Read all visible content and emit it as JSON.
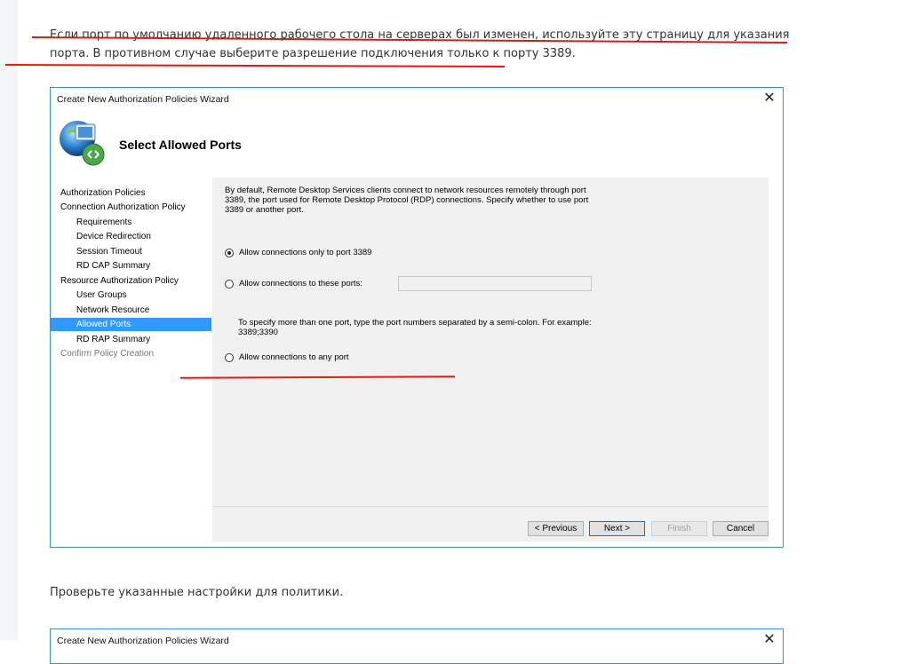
{
  "article": {
    "paragraph1": "Если порт по умолчанию удаленного рабочего стола на серверах был изменен, используйте эту страницу для указания порта. В противном случае выберите разрешение подключения только к порту 3389.",
    "paragraph2": "Проверьте указанные настройки для политики."
  },
  "dialog": {
    "window_title": "Create New Authorization Policies Wizard",
    "close_glyph": "✕",
    "page_title": "Select Allowed Ports",
    "nav": [
      {
        "label": "Authorization Policies"
      },
      {
        "label": "Connection Authorization Policy"
      },
      {
        "label": "Requirements"
      },
      {
        "label": "Device Redirection"
      },
      {
        "label": "Session Timeout"
      },
      {
        "label": "RD CAP Summary"
      },
      {
        "label": "Resource Authorization Policy"
      },
      {
        "label": "User Groups"
      },
      {
        "label": "Network Resource"
      },
      {
        "label": "Allowed Ports"
      },
      {
        "label": "RD RAP Summary"
      },
      {
        "label": "Confirm Policy Creation"
      }
    ],
    "description": "By default, Remote Desktop Services clients connect to network resources remotely through port 3389, the port used for Remote Desktop Protocol (RDP) connections. Specify whether to use port 3389 or another port.",
    "option_only_3389": "Allow connections only to port 3389",
    "option_these_ports": "Allow connections to these ports:",
    "ports_value": "",
    "hint": "To specify more than one port, type the port numbers separated by a semi-colon. For example: 3389;3390",
    "option_any_port": "Allow connections to any port",
    "selected_option": "only_3389",
    "buttons": {
      "previous": "< Previous",
      "next": "Next >",
      "finish": "Finish",
      "cancel": "Cancel"
    }
  },
  "dialog2": {
    "window_title": "Create New Authorization Policies Wizard",
    "close_glyph": "✕"
  },
  "colors": {
    "selection": "#3399ff",
    "annotation": "#e01818",
    "window_border": "#3a8fc9"
  }
}
